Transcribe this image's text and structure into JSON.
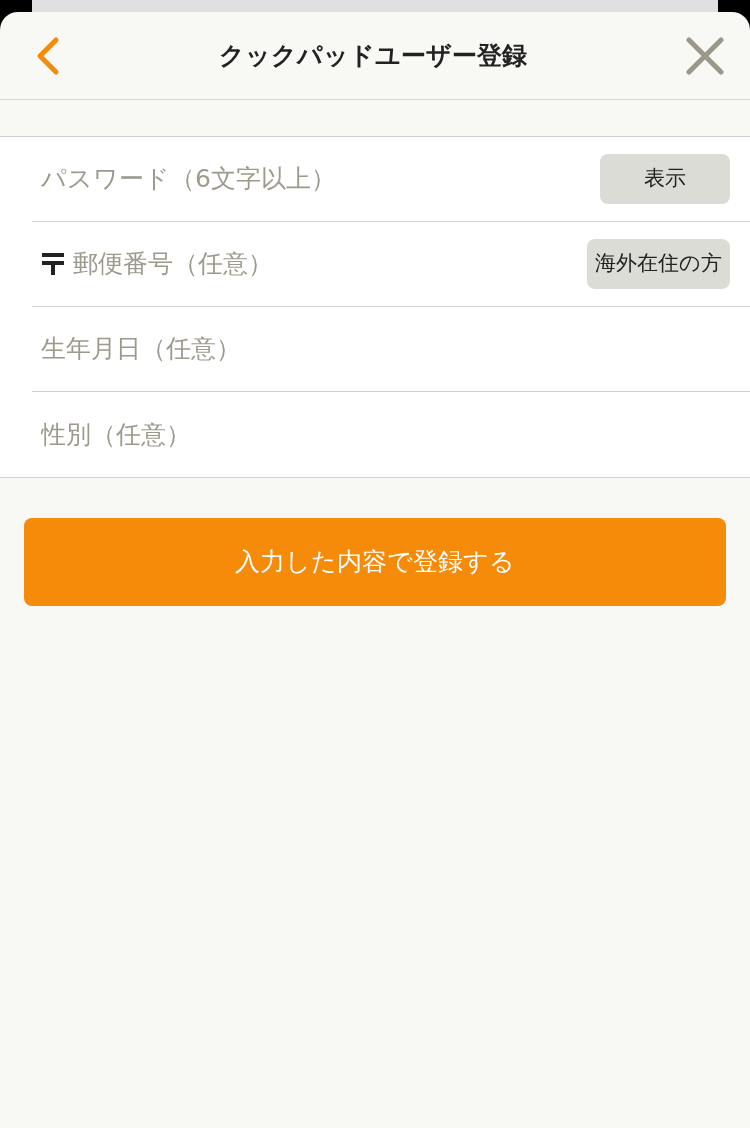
{
  "header": {
    "title": "クックパッドユーザー登録"
  },
  "fields": [
    {
      "kind": "password",
      "placeholder": "パスワード（6文字以上）",
      "button": "表示"
    },
    {
      "kind": "postal",
      "placeholder": "郵便番号（任意）",
      "button": "海外在住の方"
    },
    {
      "kind": "plain",
      "placeholder": "生年月日（任意）"
    },
    {
      "kind": "plain",
      "placeholder": "性別（任意）"
    }
  ],
  "submit": {
    "label": "入力した内容で登録する"
  }
}
